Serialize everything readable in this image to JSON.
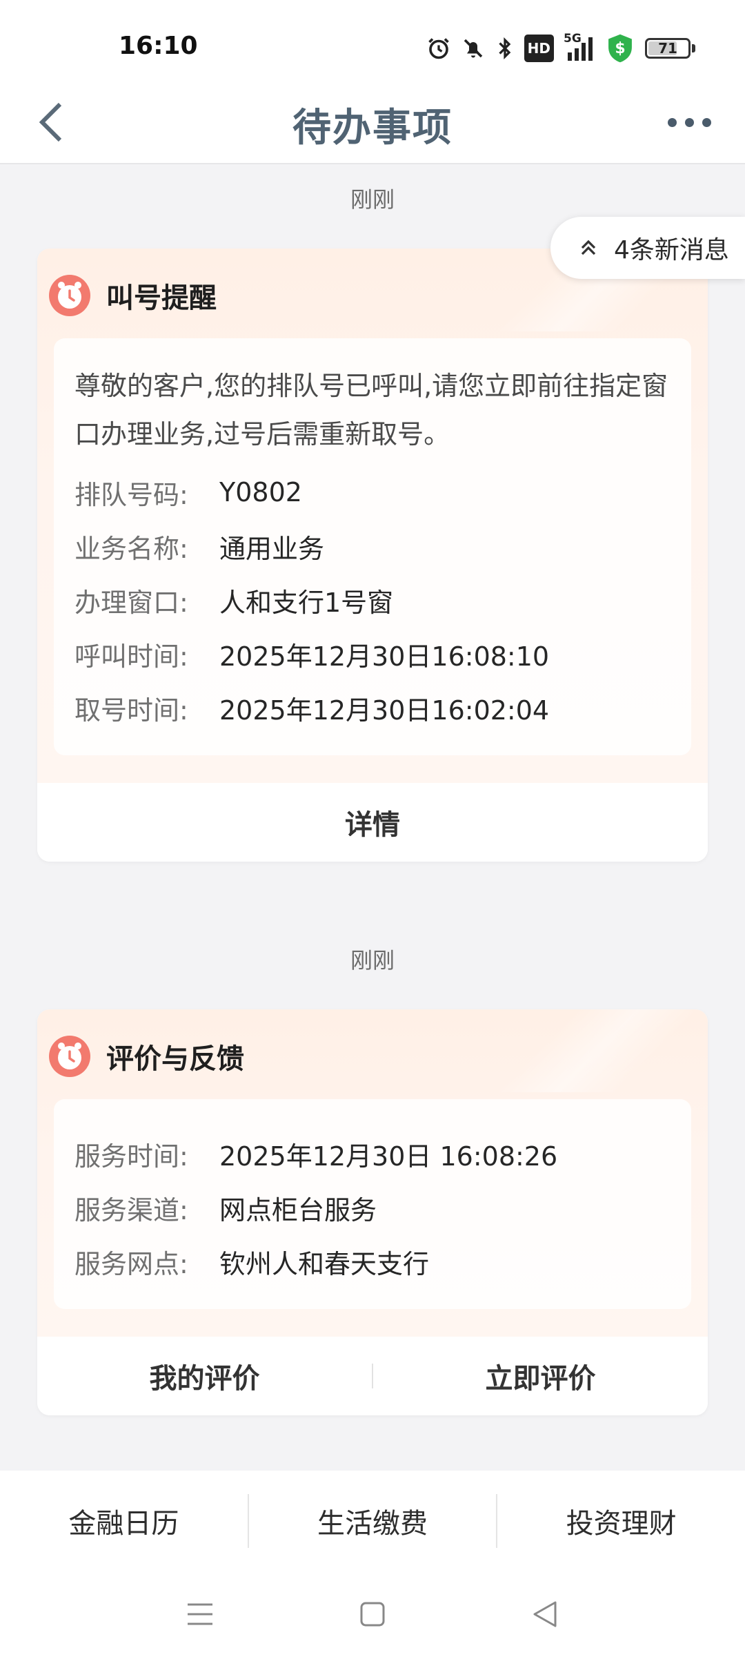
{
  "status_bar": {
    "time": "16:10",
    "network": "5G",
    "hd": "HD",
    "battery": "71"
  },
  "header": {
    "title": "待办事项"
  },
  "new_messages": {
    "label": "4条新消息"
  },
  "cards": [
    {
      "time_label": "刚刚",
      "title": "叫号提醒",
      "description": "尊敬的客户,您的排队号已呼叫,请您立即前往指定窗口办理业务,过号后需重新取号。",
      "fields": [
        {
          "key": "排队号码:",
          "value": "Y0802"
        },
        {
          "key": "业务名称:",
          "value": "通用业务"
        },
        {
          "key": "办理窗口:",
          "value": "人和支行1号窗"
        },
        {
          "key": "呼叫时间:",
          "value": "2025年12月30日16:08:10"
        },
        {
          "key": "取号时间:",
          "value": "2025年12月30日16:02:04"
        }
      ],
      "action": "详情"
    },
    {
      "time_label": "刚刚",
      "title": "评价与反馈",
      "fields": [
        {
          "key": "服务时间:",
          "value": "2025年12月30日 16:08:26"
        },
        {
          "key": "服务渠道:",
          "value": "网点柜台服务"
        },
        {
          "key": "服务网点:",
          "value": "钦州人和春天支行"
        }
      ],
      "actions": [
        "我的评价",
        "立即评价"
      ]
    }
  ],
  "bottom_tabs": [
    "金融日历",
    "生活缴费",
    "投资理财"
  ],
  "icons": {
    "back": "chevron-left-icon",
    "more": "more-dots-icon",
    "alarm": "alarm-clock-icon",
    "expand": "chevrons-up-icon"
  },
  "colors": {
    "title": "#506373",
    "alarm_icon": "#f27a6e",
    "shield": "#2fb24c"
  }
}
